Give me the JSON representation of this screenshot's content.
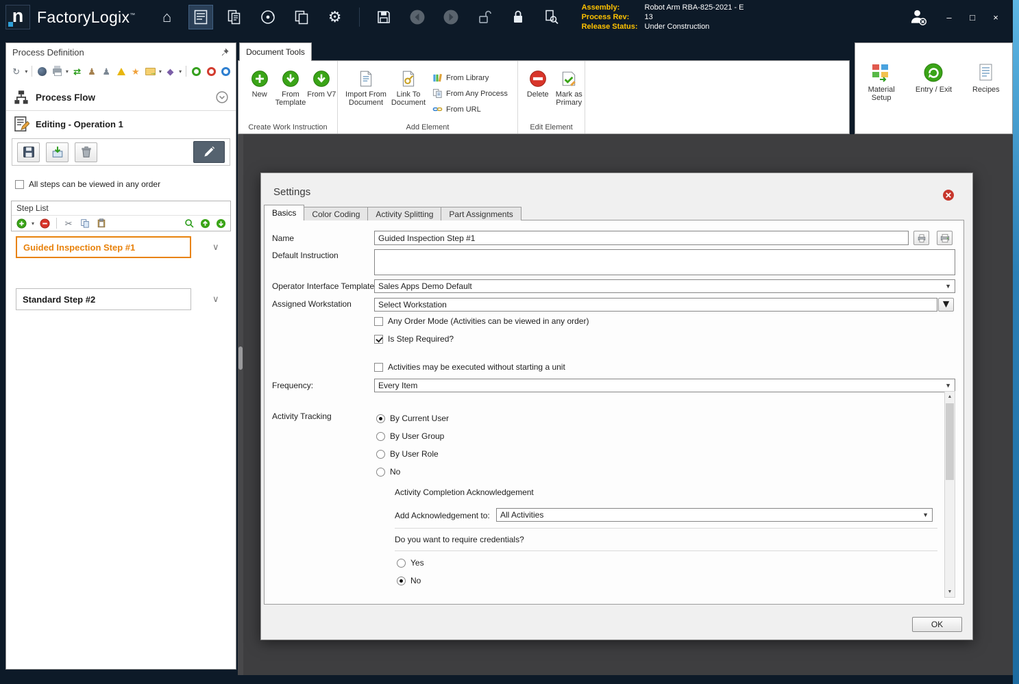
{
  "icons": {
    "home": "⌂",
    "gear": "⚙",
    "refresh": "↻",
    "sync": "⇄",
    "user": "♟",
    "star": "★",
    "arrow_right": "→",
    "diamond": "◆",
    "caret_down": "▾",
    "scissors": "✂",
    "chevron_down": "∨",
    "up_arrow": "▲",
    "down_arrow": "▼",
    "minimize": "–",
    "maximize": "□",
    "close": "×",
    "logo_letter": "n"
  },
  "titlebar": {
    "app_name": "FactoryLogix",
    "trademark": "™",
    "assembly_label": "Assembly:",
    "assembly_value": "Robot Arm RBA-825-2021 - E",
    "process_rev_label": "Process Rev:",
    "process_rev_value": "13",
    "release_status_label": "Release Status:",
    "release_status_value": "Under Construction"
  },
  "left_panel": {
    "title": "Process Definition",
    "process_flow_label": "Process Flow",
    "editing_label": "Editing - Operation 1",
    "order_checkbox_label": "All steps can be viewed in any order",
    "step_list_title": "Step List",
    "steps": [
      {
        "label": "Guided Inspection Step #1"
      },
      {
        "label": "Standard Step #2"
      }
    ]
  },
  "ribbon": {
    "tab_label": "Document Tools",
    "groups": {
      "create": {
        "label": "Create Work Instruction",
        "new_label": "New",
        "from_template_label": "From Template",
        "from_v7_label": "From V7"
      },
      "add": {
        "label": "Add Element",
        "import_label": "Import From Document",
        "link_label": "Link To Document",
        "from_library_label": "From Library",
        "from_any_process_label": "From Any Process",
        "from_url_label": "From URL"
      },
      "edit": {
        "label": "Edit Element",
        "delete_label": "Delete",
        "mark_primary_label": "Mark as Primary"
      },
      "right": {
        "material_setup_label": "Material Setup",
        "entry_exit_label": "Entry / Exit",
        "recipes_label": "Recipes"
      }
    }
  },
  "dialog": {
    "title": "Settings",
    "tabs": [
      {
        "label": "Basics"
      },
      {
        "label": "Color Coding"
      },
      {
        "label": "Activity Splitting"
      },
      {
        "label": "Part Assignments"
      }
    ],
    "fields": {
      "name_label": "Name",
      "name_value": "Guided Inspection Step #1",
      "default_instruction_label": "Default Instruction",
      "default_instruction_value": "",
      "oit_label": "Operator Interface Template",
      "oit_value": "Sales Apps Demo Default",
      "workstation_label": "Assigned Workstation",
      "workstation_value": "Select Workstation",
      "any_order_label": "Any Order Mode (Activities can be viewed in any order)",
      "step_required_label": "Is Step Required?",
      "activities_no_unit_label": "Activities may be executed without starting a unit",
      "frequency_label": "Frequency:",
      "frequency_value": "Every Item",
      "activity_tracking_label": "Activity Tracking",
      "tracking_options": [
        {
          "label": "By Current User"
        },
        {
          "label": "By User Group"
        },
        {
          "label": "By User Role"
        },
        {
          "label": "No"
        }
      ],
      "ack_section_label": "Activity Completion Acknowledgement",
      "ack_label": "Add Acknowledgement to:",
      "ack_value": "All Activities",
      "credentials_question": "Do you want to require credentials?",
      "credentials_options": [
        {
          "label": "Yes"
        },
        {
          "label": "No"
        }
      ]
    },
    "ok_label": "OK"
  }
}
